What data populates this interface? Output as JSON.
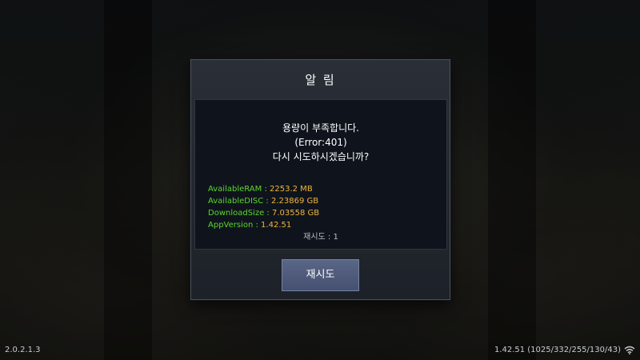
{
  "dialog": {
    "title": "알 림",
    "message_lines": [
      "용량이 부족합니다.",
      "(Error:401)",
      "다시 시도하시겠습니까?"
    ],
    "info": [
      {
        "key": "AvailableRAM : ",
        "value": "2253.2 MB"
      },
      {
        "key": "AvailableDISC : ",
        "value": "2.23869 GB"
      },
      {
        "key": "DownloadSize : ",
        "value": "7.03558 GB"
      },
      {
        "key": "AppVersion : ",
        "value": "1.42.51"
      }
    ],
    "retry_count": "재시도 : 1",
    "retry_button": "재시도"
  },
  "footer": {
    "version_left": "2.0.2.1.3",
    "version_right": "1.42.51 (1025/332/255/130/43)",
    "network_icon": "wifi-icon"
  },
  "colors": {
    "info_key": "#5bd62e",
    "info_value": "#f0b43c",
    "button": "#4f5a7a"
  }
}
